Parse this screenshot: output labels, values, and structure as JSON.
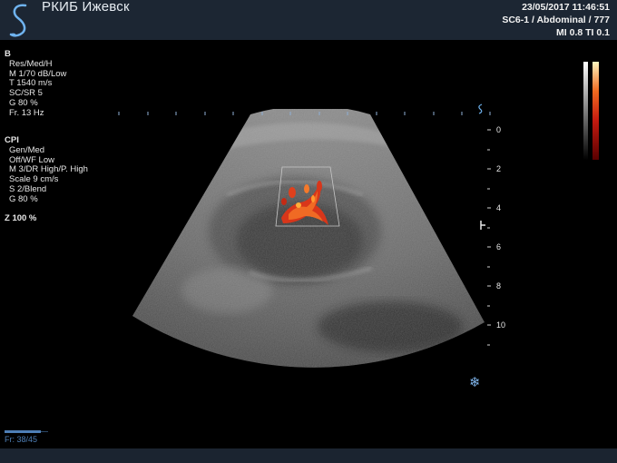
{
  "header": {
    "title": "РКИБ Ижевск",
    "datetime": "23/05/2017 11:46:51",
    "probe_preset": "SC6-1 / Abdominal / 777",
    "indices": "MI 0.8  TI 0.1",
    "logo_icon": "sonoscape-s-logo"
  },
  "b_mode": {
    "heading": "B",
    "lines": [
      "Res/Med/H",
      "M 1/70 dB/Low",
      "T 1540 m/s",
      "SC/SR 5",
      "G 80 %",
      "Fr. 13 Hz"
    ]
  },
  "cpi_mode": {
    "heading": "CPI",
    "lines": [
      "Gen/Med",
      "Off/WF Low",
      "M 3/DR High/P. High",
      "Scale 9 cm/s",
      "S 2/Blend",
      "G 80 %"
    ]
  },
  "zoom": "Z  100  %",
  "depth_scale": {
    "labels": [
      "0",
      "2",
      "4",
      "6",
      "8",
      "10"
    ]
  },
  "frame": {
    "counter": "Fr: 38/45",
    "progress": 0.84
  },
  "icons": {
    "freeze": "snowflake-icon",
    "focus_marker": "focus-marker-icon",
    "orientation": "probe-orientation-icon"
  },
  "colors": {
    "header_bg": "#1c2633",
    "accent_blue": "#4e7fb6",
    "doppler_red": "#e0401c",
    "doppler_yellow": "#ffd23a"
  }
}
